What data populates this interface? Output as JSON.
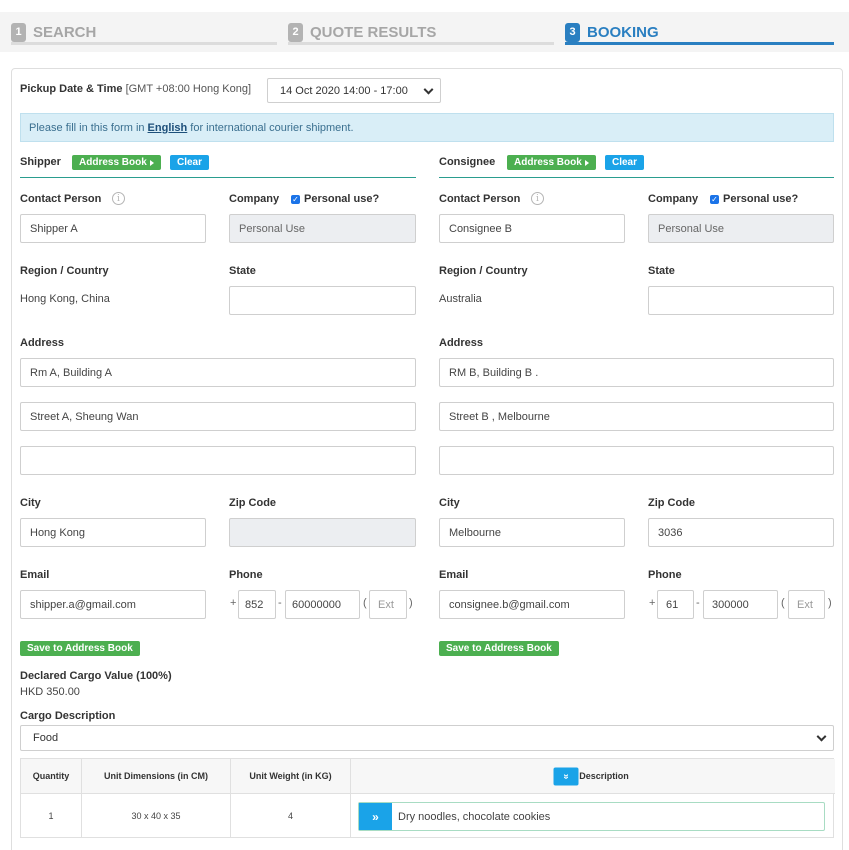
{
  "steps": [
    {
      "num": "1",
      "label": "SEARCH"
    },
    {
      "num": "2",
      "label": "QUOTE RESULTS"
    },
    {
      "num": "3",
      "label": "BOOKING"
    }
  ],
  "pickup": {
    "label": "Pickup Date & Time",
    "timezone": "[GMT +08:00 Hong Kong]",
    "value": "14 Oct 2020 14:00 - 17:00"
  },
  "notice": {
    "before": "Please fill in this form in",
    "link": "English",
    "after": "for international courier shipment."
  },
  "shipper": {
    "title": "Shipper",
    "address_book": "Address Book",
    "clear": "Clear",
    "contact_label": "Contact Person",
    "contact_value": "Shipper A",
    "company_label": "Company",
    "personal_use_label": "Personal use?",
    "company_value": "Personal Use",
    "region_label": "Region / Country",
    "region_value": "Hong Kong, China",
    "state_label": "State",
    "state_value": "",
    "address_label": "Address",
    "address1": "Rm A, Building A",
    "address2": "Street A, Sheung Wan",
    "address3": "",
    "city_label": "City",
    "city_value": "Hong Kong",
    "zip_label": "Zip Code",
    "zip_value": "",
    "email_label": "Email",
    "email_value": "shipper.a@gmail.com",
    "phone_label": "Phone",
    "phone_code": "852",
    "phone_number": "60000000",
    "ext_placeholder": "Ext",
    "save_label": "Save to Address Book"
  },
  "consignee": {
    "title": "Consignee",
    "address_book": "Address Book",
    "clear": "Clear",
    "contact_label": "Contact Person",
    "contact_value": "Consignee B",
    "company_label": "Company",
    "personal_use_label": "Personal use?",
    "company_value": "Personal Use",
    "region_label": "Region / Country",
    "region_value": "Australia",
    "state_label": "State",
    "state_value": "",
    "address_label": "Address",
    "address1": "RM B, Building B .",
    "address2": "Street B , Melbourne",
    "address3": "",
    "city_label": "City",
    "city_value": "Melbourne",
    "zip_label": "Zip Code",
    "zip_value": "3036",
    "email_label": "Email",
    "email_value": "consignee.b@gmail.com",
    "phone_label": "Phone",
    "phone_code": "61",
    "phone_number": "300000",
    "ext_placeholder": "Ext",
    "save_label": "Save to Address Book"
  },
  "phone_symbols": {
    "plus": "+",
    "dash": "-",
    "open": "(",
    "close": ")"
  },
  "cargo": {
    "declared_label": "Declared Cargo Value (100%)",
    "declared_value": "HKD 350.00",
    "description_label": "Cargo Description",
    "description_value": "Food"
  },
  "table": {
    "headers": [
      "Quantity",
      "Unit Dimensions (in CM)",
      "Unit Weight (in KG)",
      "Description"
    ],
    "rows": [
      {
        "quantity": "1",
        "dimensions": "30 x 40 x 35",
        "weight": "4",
        "description": "Dry noodles, chocolate cookies"
      }
    ]
  },
  "icons": {
    "info": "i",
    "check": "✓",
    "double_down": "»",
    "double_right": "»"
  },
  "colors": {
    "accent": "#2a7fc1",
    "green": "#4caf50",
    "blue_button": "#1aa3e8",
    "teal_line": "#2a9d8f"
  }
}
